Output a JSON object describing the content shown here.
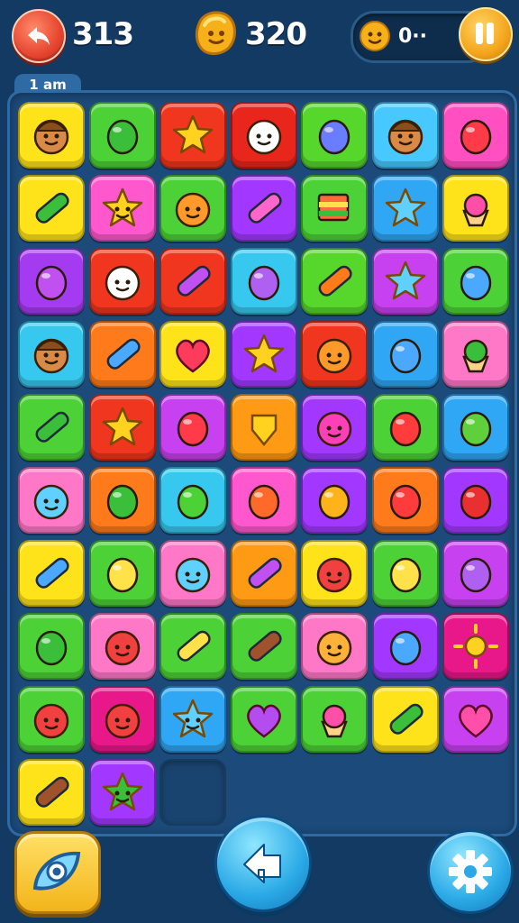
{
  "hud": {
    "score": "313",
    "coins": "320",
    "lives": "0··"
  },
  "board": {
    "tab_label": "1 am",
    "rows": [
      [
        {
          "color": "#ffe31a",
          "icon": "acorn-face-icon"
        },
        {
          "color": "#4cd137",
          "icon": "leaf-icon"
        },
        {
          "color": "#f0361e",
          "icon": "star-icon"
        },
        {
          "color": "#e8261c",
          "icon": "ghost-face-icon"
        },
        {
          "color": "#57d62c",
          "icon": "blueberry-icon"
        },
        {
          "color": "#47c8ff",
          "icon": "acorn-face-icon"
        },
        {
          "color": "#ff4fc1",
          "icon": "apple-icon"
        }
      ],
      [
        {
          "color": "#ffe31a",
          "icon": "caterpillar-icon"
        },
        {
          "color": "#ff58cf",
          "icon": "star-face-icon"
        },
        {
          "color": "#4cd137",
          "icon": "fox-face-icon"
        },
        {
          "color": "#a238ff",
          "icon": "candy-icon"
        },
        {
          "color": "#4cd137",
          "icon": "flag-icon"
        },
        {
          "color": "#2fa7f5",
          "icon": "blue-star-icon"
        },
        {
          "color": "#ffe31a",
          "icon": "cupcake-icon"
        }
      ],
      [
        {
          "color": "#a53bf0",
          "icon": "purple-gem-icon"
        },
        {
          "color": "#f0361e",
          "icon": "ghost-face-icon"
        },
        {
          "color": "#f0361e",
          "icon": "purple-pencil-icon"
        },
        {
          "color": "#37c8f0",
          "icon": "egg-icon"
        },
        {
          "color": "#57d62c",
          "icon": "carrot-icon"
        },
        {
          "color": "#c741f0",
          "icon": "blue-star-icon"
        },
        {
          "color": "#4cd137",
          "icon": "blue-drop-icon"
        }
      ],
      [
        {
          "color": "#37c8f0",
          "icon": "acorn-face-icon"
        },
        {
          "color": "#ff7a1a",
          "icon": "blue-capsule-icon"
        },
        {
          "color": "#ffe31a",
          "icon": "heart-icon"
        },
        {
          "color": "#a238ff",
          "icon": "star-icon"
        },
        {
          "color": "#f0361e",
          "icon": "fox-face-icon"
        },
        {
          "color": "#2fa7f5",
          "icon": "blue-blob-icon"
        },
        {
          "color": "#ff78c8",
          "icon": "broccoli-icon"
        }
      ],
      [
        {
          "color": "#4cd137",
          "icon": "crayon-icon"
        },
        {
          "color": "#f0361e",
          "icon": "star-icon"
        },
        {
          "color": "#c741f0",
          "icon": "apple-icon"
        },
        {
          "color": "#ff9a14",
          "icon": "yellow-gem-icon"
        },
        {
          "color": "#a238ff",
          "icon": "spiky-creature-icon"
        },
        {
          "color": "#4cd137",
          "icon": "strawberry-icon"
        },
        {
          "color": "#2fa7f5",
          "icon": "green-egg-icon"
        }
      ],
      [
        {
          "color": "#ff78c8",
          "icon": "blue-creature-icon"
        },
        {
          "color": "#ff7a1a",
          "icon": "green-dragon-icon"
        },
        {
          "color": "#37c8f0",
          "icon": "lime-icon"
        },
        {
          "color": "#ff58cf",
          "icon": "peach-icon"
        },
        {
          "color": "#a238ff",
          "icon": "mango-icon"
        },
        {
          "color": "#ff7a1a",
          "icon": "red-pepper-icon"
        },
        {
          "color": "#a238ff",
          "icon": "red-egg-icon"
        }
      ],
      [
        {
          "color": "#ffe31a",
          "icon": "blue-capsule-icon"
        },
        {
          "color": "#4cd137",
          "icon": "lemon-icon"
        },
        {
          "color": "#ff78c8",
          "icon": "blue-creature-icon"
        },
        {
          "color": "#ff9a14",
          "icon": "purple-capsule-icon"
        },
        {
          "color": "#ffe31a",
          "icon": "red-monster-icon"
        },
        {
          "color": "#4cd137",
          "icon": "lemon-icon"
        },
        {
          "color": "#c741f0",
          "icon": "purple-egg-icon"
        }
      ],
      [
        {
          "color": "#4cd137",
          "icon": "blue-leaf-icon"
        },
        {
          "color": "#ff78c8",
          "icon": "red-creature-icon"
        },
        {
          "color": "#4cd137",
          "icon": "banana-icon"
        },
        {
          "color": "#4cd137",
          "icon": "brown-crayon-icon"
        },
        {
          "color": "#ff78c8",
          "icon": "smiley-face-icon"
        },
        {
          "color": "#a238ff",
          "icon": "blue-fish-icon"
        },
        {
          "color": "#e8188a",
          "icon": "sun-icon"
        }
      ],
      [
        {
          "color": "#4cd137",
          "icon": "red-drop-creature-icon"
        },
        {
          "color": "#e8188a",
          "icon": "red-flower-creature-icon"
        },
        {
          "color": "#2fa7f5",
          "icon": "blue-star-face-icon"
        },
        {
          "color": "#4cd137",
          "icon": "purple-heart-icon"
        },
        {
          "color": "#4cd137",
          "icon": "ice-cream-icon"
        },
        {
          "color": "#ffe31a",
          "icon": "caterpillar-icon"
        },
        {
          "color": "#c741f0",
          "icon": "pink-heart-icon"
        }
      ],
      [
        {
          "color": "#ffe31a",
          "icon": "brown-crayon-icon"
        },
        {
          "color": "#a238ff",
          "icon": "green-star-creature-icon"
        },
        {
          "color": "#1a4470",
          "icon": "empty-slot"
        }
      ]
    ]
  },
  "controls": {
    "hint": {
      "icon": "eye-icon"
    },
    "undo": {
      "icon": "undo-arrow-icon"
    },
    "settings": {
      "icon": "gear-icon"
    }
  }
}
